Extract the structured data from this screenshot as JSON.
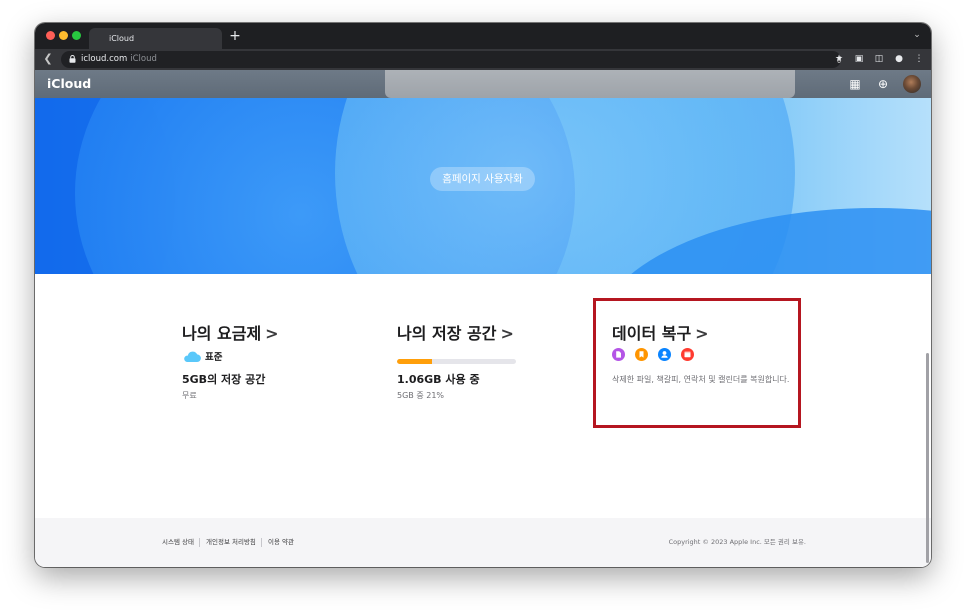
{
  "browser": {
    "tab_title": "iCloud",
    "new_tab_symbol": "+",
    "url_host": "icloud.com",
    "url_page_title": "iCloud"
  },
  "header": {
    "brand": "iCloud",
    "apple_glyph": ""
  },
  "hero": {
    "customize_label": "홈페이지 사용자화"
  },
  "cards": {
    "plan": {
      "title": "나의 요금제",
      "chevron": ">",
      "plan_name": "표준",
      "storage": "5GB의 저장 공간",
      "price": "무료"
    },
    "storage": {
      "title": "나의 저장 공간",
      "chevron": ">",
      "used": "1.06GB 사용 중",
      "detail": "5GB 중 21%",
      "percent": 21
    },
    "recovery": {
      "title": "데이터 복구",
      "chevron": ">",
      "icons": [
        "files-icon",
        "bookmarks-icon",
        "contacts-icon",
        "calendar-icon"
      ],
      "icon_colors": [
        "#b455e6",
        "#ff9500",
        "#0a84ff",
        "#ff3b30"
      ],
      "description": "삭제한 파일, 책갈피, 연락처 및 캘린더를 복원합니다."
    }
  },
  "footer": {
    "links": [
      "시스템 상태",
      "개인정보 처리방침",
      "이용 약관"
    ],
    "copyright": "Copyright © 2023 Apple Inc. 모든 권리 보유."
  },
  "colors": {
    "accent_storage": "#ff9f0a",
    "highlight_border": "#b51620",
    "cloud": "#5ac8fa"
  }
}
